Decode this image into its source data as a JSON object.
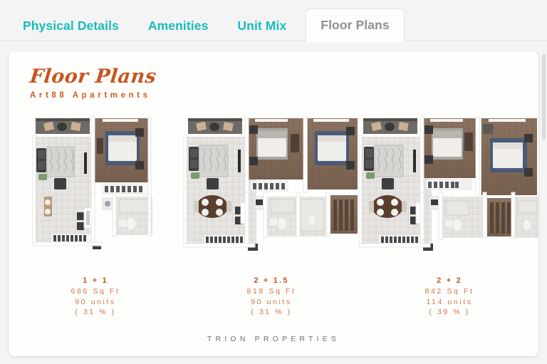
{
  "tabs": [
    {
      "label": "Physical Details",
      "active": false
    },
    {
      "label": "Amenities",
      "active": false
    },
    {
      "label": "Unit Mix",
      "active": false
    },
    {
      "label": "Floor Plans",
      "active": true
    }
  ],
  "card": {
    "title": "Floor Plans",
    "subtitle": "Art88 Apartments",
    "footer_brand": "TRION PROPERTIES"
  },
  "plans": [
    {
      "type": "1 + 1",
      "area": "686 Sq Ft",
      "units": "90 units",
      "share": "( 31 % )",
      "image_alt": "floor-plan-1bed-1bath"
    },
    {
      "type": "2 + 1.5",
      "area": "818 Sq Ft",
      "units": "90 units",
      "share": "( 31 % )",
      "image_alt": "floor-plan-2bed-1-5bath"
    },
    {
      "type": "2 + 2",
      "area": "842 Sq Ft",
      "units": "114 units",
      "share": "( 39 % )",
      "image_alt": "floor-plan-2bed-2bath"
    }
  ],
  "colors": {
    "tab_active_text": "#909090",
    "tab_inactive_text": "#19bcbd",
    "accent_orange": "#c8551f",
    "caption_orange": "#d2764a",
    "card_background": "#fefefc",
    "page_background": "#f4f4f4",
    "footer_text": "#6f6f6f"
  }
}
